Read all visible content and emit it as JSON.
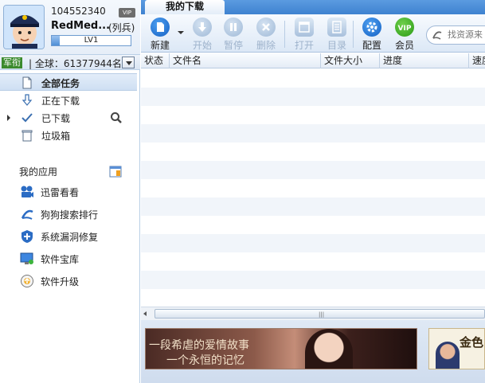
{
  "profile": {
    "user_id": "104552340",
    "vip_badge": "VIP",
    "user_name": "RedMed...",
    "rank_title": "(列兵)",
    "level": "LV1",
    "level_progress": 0.1
  },
  "rank": {
    "tag": "军衔",
    "text": "| 全球：61377944名"
  },
  "nav": {
    "items": [
      {
        "label": "全部任务",
        "icon": "document-icon"
      },
      {
        "label": "正在下载",
        "icon": "download-arrow-icon"
      },
      {
        "label": "已下载",
        "icon": "checkmark-icon"
      },
      {
        "label": "垃圾箱",
        "icon": "trash-icon"
      }
    ]
  },
  "apps": {
    "header": "我的应用",
    "items": [
      {
        "label": "迅雷看看",
        "icon": "film-camera-icon"
      },
      {
        "label": "狗狗搜索排行",
        "icon": "search-rank-icon"
      },
      {
        "label": "系统漏洞修复",
        "icon": "shield-icon"
      },
      {
        "label": "软件宝库",
        "icon": "monitor-icon"
      },
      {
        "label": "软件升级",
        "icon": "upgrade-icon"
      }
    ]
  },
  "tabs": {
    "downloads": "我的下载"
  },
  "toolbar": {
    "new": "新建",
    "start": "开始",
    "pause": "暂停",
    "delete": "删除",
    "open": "打开",
    "folder": "目录",
    "config": "配置",
    "vip": "会员",
    "vip_icon_text": "VIP"
  },
  "search": {
    "placeholder": "找资源来"
  },
  "table": {
    "columns": [
      "状态",
      "文件名",
      "文件大小",
      "进度",
      "速度"
    ],
    "rows": []
  },
  "ads": {
    "main_line1": "一段希虐的爱情故事",
    "main_line2": "一个永恒的记忆",
    "second_text": "金色"
  },
  "colors": {
    "accent": "#3e82d0",
    "military_green": "#3b8a2c",
    "toolbar_blue": "#1461c4"
  }
}
